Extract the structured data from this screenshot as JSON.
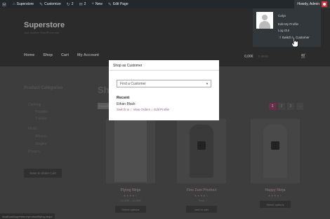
{
  "admin_bar": {
    "site_name": "Superstore",
    "customize": "Customize",
    "updates_count": "2",
    "comments_count": "2",
    "new_label": "New",
    "edit_page": "Edit Page",
    "greeting": "Howdy, Admin"
  },
  "user_menu": {
    "items": [
      "Calyx",
      "Edit My Profile",
      "Log Out",
      "Switch to Customer"
    ]
  },
  "header": {
    "site_title": "Superstore",
    "tagline": "Just another WordPress site",
    "nav": [
      "Home",
      "Shop",
      "Cart",
      "My Account"
    ],
    "cart_total": "0,00€",
    "cart_items": "0 items"
  },
  "sidebar": {
    "title": "Product Categories",
    "categories": [
      "Clothing",
      "Hoodies",
      "T-shirts",
      "Music",
      "Albums",
      "Singles",
      "Posters"
    ],
    "save_cart": "Save & Share Cart"
  },
  "shop": {
    "heading": "Shop",
    "sort_label": "Default",
    "pages": [
      "1",
      "2",
      "3",
      "→"
    ],
    "products": [
      {
        "name": "Flying Ninja",
        "rating": "★★★★☆",
        "price": "12,00€ – 14,00€",
        "button": "Select options"
      },
      {
        "name": "Fine Zum Product",
        "rating": "★★★★☆",
        "price": "Free",
        "button": "Add to cart"
      },
      {
        "name": "Happy Ninja",
        "rating": "★★★★☆",
        "price": "",
        "button": "Select options"
      }
    ]
  },
  "modal": {
    "title": "Shop as Customer",
    "select_placeholder": "Find a Customer",
    "recent_heading": "Recent",
    "recent_customer": "Ethan Black",
    "links": [
      "Switch to",
      "View Orders",
      "Edit Profile"
    ]
  },
  "status_bar": {
    "url": "localhost/superstore/product/flying-ninja/"
  },
  "colors": {
    "admin_bar": "#23282d",
    "link": "#96588a",
    "pager_active": "#6b2d4a"
  }
}
